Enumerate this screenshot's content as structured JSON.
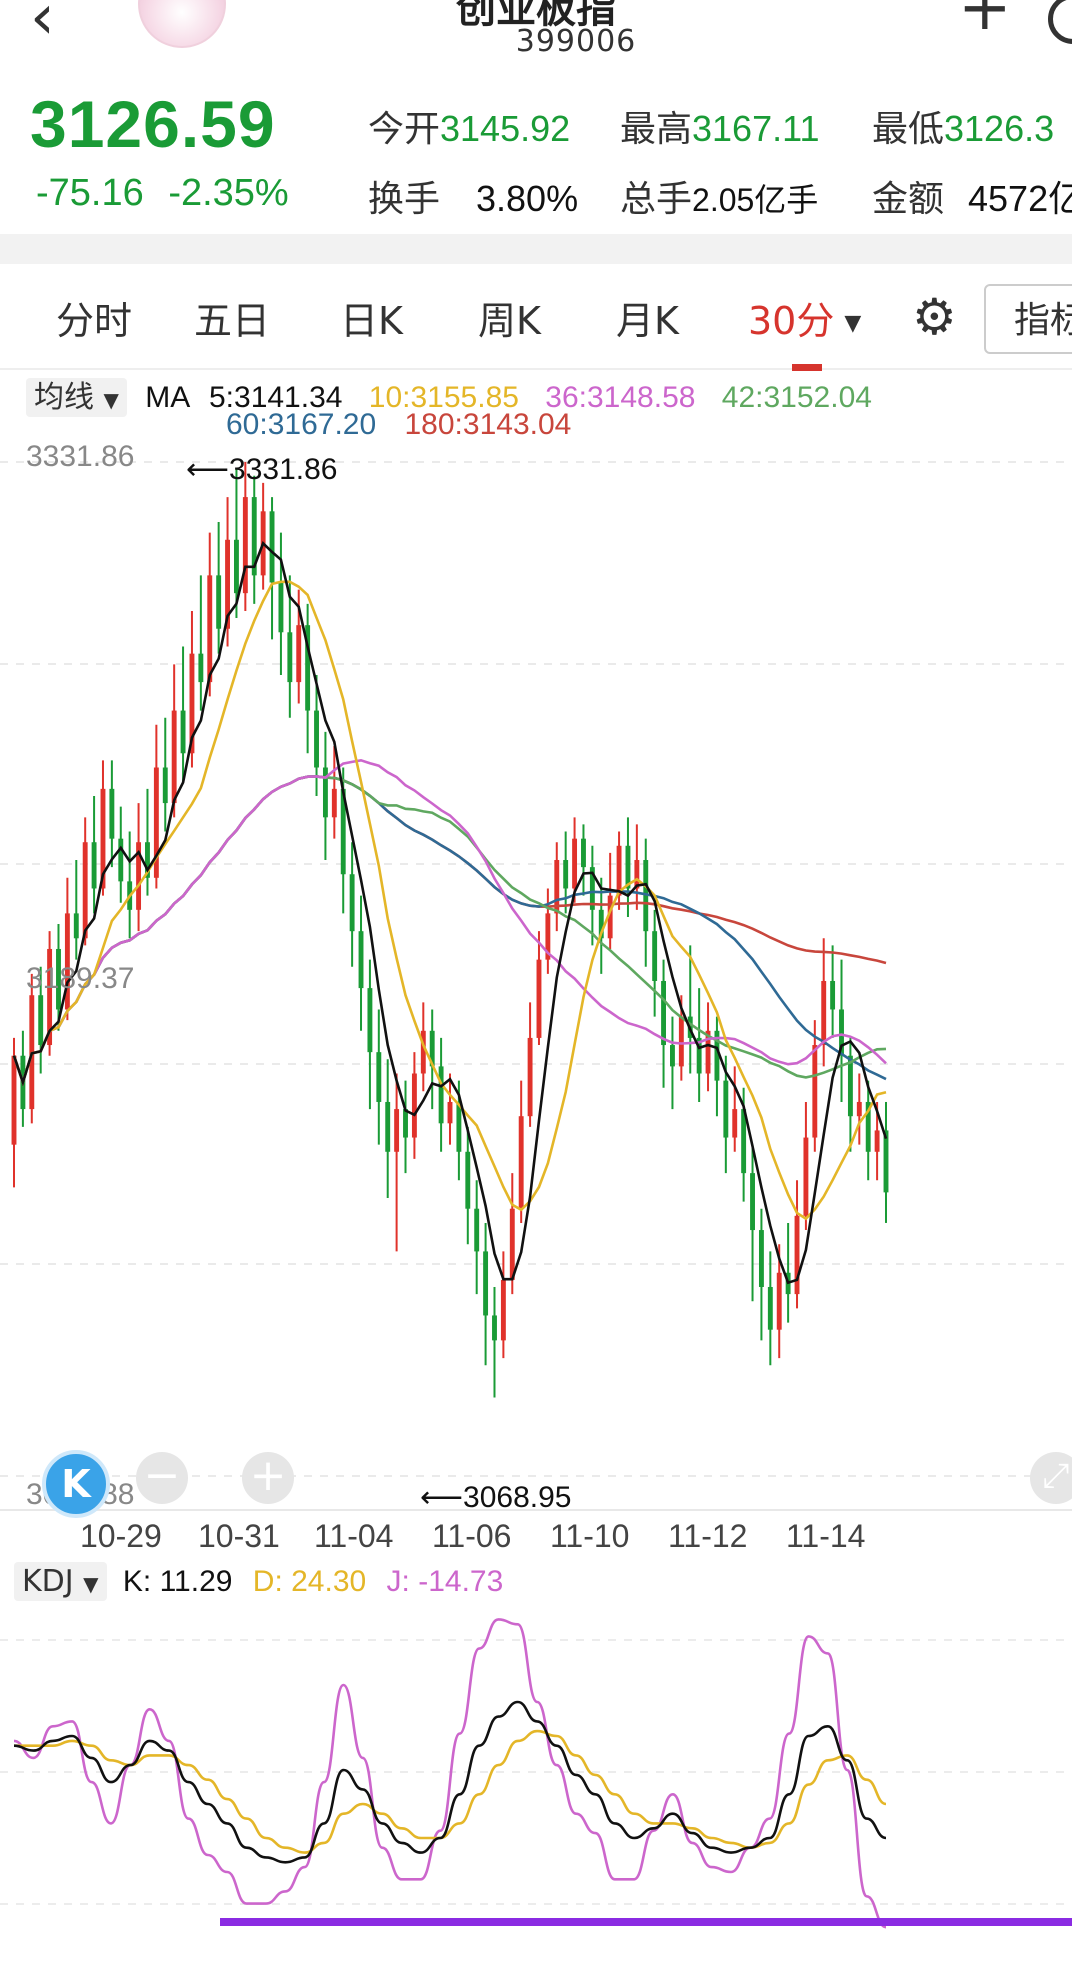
{
  "header": {
    "title": "创业板指",
    "code": "399006"
  },
  "quote": {
    "price": "3126.59",
    "change": "-75.16",
    "change_pct": "-2.35%",
    "open_label": "今开",
    "open": "3145.92",
    "high_label": "最高",
    "high": "3167.11",
    "low_label": "最低",
    "low": "3126.3",
    "turnover_label": "换手",
    "turnover": "3.80%",
    "volume_label": "总手",
    "volume": "2.05亿手",
    "amount_label": "金额",
    "amount": "4572亿",
    "color_down": "#1a9b36"
  },
  "tabs": {
    "items": [
      "分时",
      "五日",
      "日K",
      "周K",
      "月K",
      "30分"
    ],
    "active": "30分",
    "dropdown_arrow": "▼",
    "indicator_button": "指标",
    "active_color": "#d6342d"
  },
  "ma_legend": {
    "selector": "均线",
    "prefix": "MA",
    "items": [
      {
        "label": "5:3141.34",
        "color": "#111111"
      },
      {
        "label": "10:3155.85",
        "color": "#e4b628"
      },
      {
        "label": "36:3148.58",
        "color": "#cc66cc"
      },
      {
        "label": "42:3152.04",
        "color": "#5fa860"
      },
      {
        "label": "60:3167.20",
        "color": "#2f6a95"
      },
      {
        "label": "180:3143.04",
        "color": "#c8463c"
      }
    ]
  },
  "kdj_legend": {
    "selector": "KDJ",
    "items": [
      {
        "label": "K: 11.29",
        "color": "#111111"
      },
      {
        "label": "D: 24.30",
        "color": "#e4b628"
      },
      {
        "label": "J: -14.73",
        "color": "#cc66cc"
      }
    ]
  },
  "chart_data": [
    {
      "type": "candlestick",
      "timeframe": "30分",
      "y_axis_labels": [
        "3331.86",
        "3189.37",
        "3046.88"
      ],
      "ylim": [
        3046.88,
        3331.86
      ],
      "annotations": {
        "high_mark": "3331.86",
        "low_mark": "3068.95"
      },
      "x_tick_labels": [
        "10-29",
        "10-31",
        "11-04",
        "11-06",
        "11-10",
        "11-12",
        "11-14"
      ],
      "colors": {
        "up": "#e0322b",
        "down": "#1a9b36"
      },
      "candles": [
        [
          3140,
          3165,
          3128,
          3170
        ],
        [
          3165,
          3150,
          3145,
          3172
        ],
        [
          3150,
          3182,
          3146,
          3188
        ],
        [
          3182,
          3168,
          3160,
          3190
        ],
        [
          3168,
          3195,
          3165,
          3200
        ],
        [
          3195,
          3178,
          3172,
          3202
        ],
        [
          3178,
          3205,
          3175,
          3215
        ],
        [
          3205,
          3198,
          3192,
          3220
        ],
        [
          3198,
          3225,
          3196,
          3232
        ],
        [
          3225,
          3212,
          3205,
          3238
        ],
        [
          3212,
          3240,
          3210,
          3248
        ],
        [
          3240,
          3226,
          3218,
          3248
        ],
        [
          3226,
          3214,
          3208,
          3235
        ],
        [
          3214,
          3206,
          3198,
          3228
        ],
        [
          3206,
          3225,
          3200,
          3236
        ],
        [
          3225,
          3215,
          3210,
          3240
        ],
        [
          3215,
          3246,
          3212,
          3258
        ],
        [
          3246,
          3236,
          3228,
          3260
        ],
        [
          3236,
          3262,
          3232,
          3275
        ],
        [
          3262,
          3250,
          3242,
          3280
        ],
        [
          3250,
          3278,
          3246,
          3290
        ],
        [
          3278,
          3270,
          3262,
          3300
        ],
        [
          3270,
          3300,
          3266,
          3312
        ],
        [
          3300,
          3285,
          3278,
          3315
        ],
        [
          3285,
          3310,
          3280,
          3322
        ],
        [
          3310,
          3295,
          3288,
          3330
        ],
        [
          3295,
          3322,
          3290,
          3331.86
        ],
        [
          3322,
          3300,
          3292,
          3328
        ],
        [
          3300,
          3318,
          3296,
          3326
        ],
        [
          3318,
          3298,
          3282,
          3322
        ],
        [
          3298,
          3284,
          3272,
          3312
        ],
        [
          3284,
          3270,
          3260,
          3300
        ],
        [
          3270,
          3286,
          3264,
          3296
        ],
        [
          3286,
          3262,
          3250,
          3292
        ],
        [
          3262,
          3246,
          3238,
          3272
        ],
        [
          3246,
          3232,
          3220,
          3256
        ],
        [
          3232,
          3240,
          3226,
          3252
        ],
        [
          3240,
          3216,
          3205,
          3246
        ],
        [
          3216,
          3200,
          3190,
          3225
        ],
        [
          3200,
          3184,
          3172,
          3210
        ],
        [
          3184,
          3166,
          3150,
          3192
        ],
        [
          3166,
          3152,
          3140,
          3178
        ],
        [
          3152,
          3138,
          3125,
          3164
        ],
        [
          3138,
          3150,
          3110,
          3160
        ],
        [
          3150,
          3142,
          3132,
          3158
        ],
        [
          3142,
          3160,
          3136,
          3166
        ],
        [
          3160,
          3172,
          3155,
          3180
        ],
        [
          3172,
          3162,
          3150,
          3178
        ],
        [
          3162,
          3146,
          3138,
          3170
        ],
        [
          3146,
          3152,
          3140,
          3160
        ],
        [
          3152,
          3138,
          3130,
          3158
        ],
        [
          3138,
          3122,
          3112,
          3145
        ],
        [
          3122,
          3110,
          3098,
          3130
        ],
        [
          3110,
          3092,
          3078,
          3118
        ],
        [
          3092,
          3085,
          3068.95,
          3100
        ],
        [
          3085,
          3102,
          3080,
          3110
        ],
        [
          3102,
          3122,
          3098,
          3132
        ],
        [
          3122,
          3148,
          3118,
          3158
        ],
        [
          3148,
          3170,
          3145,
          3180
        ],
        [
          3170,
          3192,
          3168,
          3200
        ],
        [
          3192,
          3205,
          3188,
          3212
        ],
        [
          3205,
          3220,
          3200,
          3225
        ],
        [
          3220,
          3212,
          3205,
          3228
        ],
        [
          3212,
          3226,
          3208,
          3232
        ],
        [
          3226,
          3218,
          3210,
          3230
        ],
        [
          3218,
          3206,
          3196,
          3224
        ],
        [
          3206,
          3198,
          3188,
          3215
        ],
        [
          3198,
          3210,
          3195,
          3222
        ],
        [
          3210,
          3224,
          3206,
          3228
        ],
        [
          3224,
          3212,
          3204,
          3232
        ],
        [
          3212,
          3220,
          3206,
          3230
        ],
        [
          3220,
          3200,
          3190,
          3226
        ],
        [
          3200,
          3186,
          3176,
          3206
        ],
        [
          3186,
          3168,
          3156,
          3192
        ],
        [
          3168,
          3162,
          3150,
          3176
        ],
        [
          3162,
          3176,
          3158,
          3182
        ],
        [
          3176,
          3170,
          3160,
          3196
        ],
        [
          3170,
          3160,
          3152,
          3184
        ],
        [
          3160,
          3172,
          3155,
          3180
        ],
        [
          3172,
          3158,
          3148,
          3176
        ],
        [
          3158,
          3142,
          3132,
          3165
        ],
        [
          3142,
          3150,
          3138,
          3162
        ],
        [
          3150,
          3132,
          3124,
          3156
        ],
        [
          3132,
          3116,
          3096,
          3140
        ],
        [
          3116,
          3100,
          3085,
          3122
        ],
        [
          3100,
          3088,
          3078,
          3110
        ],
        [
          3088,
          3104,
          3080,
          3112
        ],
        [
          3104,
          3098,
          3090,
          3118
        ],
        [
          3098,
          3120,
          3094,
          3130
        ],
        [
          3120,
          3142,
          3116,
          3152
        ],
        [
          3142,
          3168,
          3138,
          3175
        ],
        [
          3168,
          3186,
          3162,
          3198
        ],
        [
          3186,
          3178,
          3170,
          3196
        ],
        [
          3178,
          3165,
          3152,
          3192
        ],
        [
          3165,
          3148,
          3138,
          3170
        ],
        [
          3148,
          3152,
          3140,
          3160
        ],
        [
          3152,
          3138,
          3130,
          3158
        ],
        [
          3138,
          3144,
          3130,
          3152
        ],
        [
          3144,
          3126.59,
          3118,
          3152
        ]
      ]
    },
    {
      "type": "line",
      "indicator": "KDJ",
      "series": [
        {
          "name": "K",
          "color": "#111111",
          "values": [
            60,
            58,
            62,
            64,
            55,
            45,
            52,
            62,
            58,
            45,
            36,
            28,
            18,
            14,
            12,
            14,
            28,
            50,
            42,
            28,
            20,
            16,
            22,
            40,
            60,
            72,
            78,
            70,
            60,
            48,
            40,
            28,
            22,
            26,
            32,
            24,
            18,
            16,
            18,
            22,
            40,
            64,
            68,
            54,
            30,
            22
          ]
        },
        {
          "name": "D",
          "color": "#e4b628",
          "values": [
            60,
            60,
            60,
            62,
            60,
            54,
            52,
            56,
            56,
            52,
            46,
            38,
            30,
            22,
            18,
            16,
            20,
            32,
            36,
            32,
            26,
            22,
            22,
            28,
            40,
            52,
            62,
            66,
            64,
            56,
            48,
            40,
            32,
            28,
            28,
            26,
            22,
            20,
            18,
            20,
            28,
            44,
            54,
            56,
            46,
            36
          ]
        },
        {
          "name": "J",
          "color": "#cc66cc",
          "values": [
            62,
            55,
            68,
            70,
            45,
            28,
            52,
            75,
            62,
            30,
            15,
            8,
            -5,
            -5,
            0,
            10,
            45,
            85,
            55,
            18,
            5,
            5,
            25,
            65,
            100,
            112,
            110,
            78,
            52,
            32,
            24,
            5,
            5,
            25,
            40,
            20,
            10,
            8,
            18,
            30,
            65,
            105,
            98,
            50,
            -2,
            -14.73
          ]
        }
      ]
    }
  ]
}
